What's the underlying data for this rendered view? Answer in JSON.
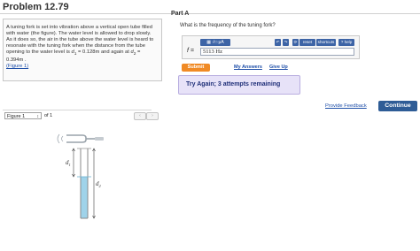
{
  "problem": {
    "title": "Problem 12.79",
    "text": "A tuning fork is set into vibration above a vertical open tube filled with water (the figure). The water level is allowed to drop slowly. As it does so, the air in the tube above the water level is heard to resonate with the tuning fork when the distance from the tube opening to the water level is ",
    "d1_symbol": "d",
    "d1_subscript": "1",
    "d1_value": " = 0.128m and again at ",
    "d2_symbol": "d",
    "d2_subscript": "2",
    "d2_value": " = 0.394m .",
    "figure_link": "(Figure 1)"
  },
  "figure_nav": {
    "selected": "Figure 1",
    "of_label": "of 1",
    "prev": "‹",
    "next": "›"
  },
  "figure": {
    "label_d1": "d",
    "label_d1_sub": "1",
    "label_d2": "d",
    "label_d2_sub": "2",
    "water_color": "#9fd3ea"
  },
  "part": {
    "label": "Part A",
    "question": "What is the frequency of the tuning fork?",
    "toolbar_left": "▦ √□ μA",
    "toolbar_undo": "↶",
    "toolbar_redo": "↷",
    "toolbar_refresh": "⟳",
    "toolbar_reset": "reset",
    "toolbar_shortcuts": "shortcuts",
    "toolbar_help": "? help",
    "variable_label": "f =",
    "answer_value": "5113  Hz",
    "submit_label": "Submit",
    "my_answers_label": "My Answers",
    "give_up_label": "Give Up",
    "feedback": "Try Again; 3 attempts remaining"
  },
  "footer": {
    "provide_feedback": "Provide Feedback",
    "continue_label": "Continue"
  },
  "colors": {
    "accent_blue": "#2e5c96",
    "submit_orange": "#f08a25",
    "feedback_bg": "#e7e2f8",
    "link_blue": "#1f4fa8"
  }
}
